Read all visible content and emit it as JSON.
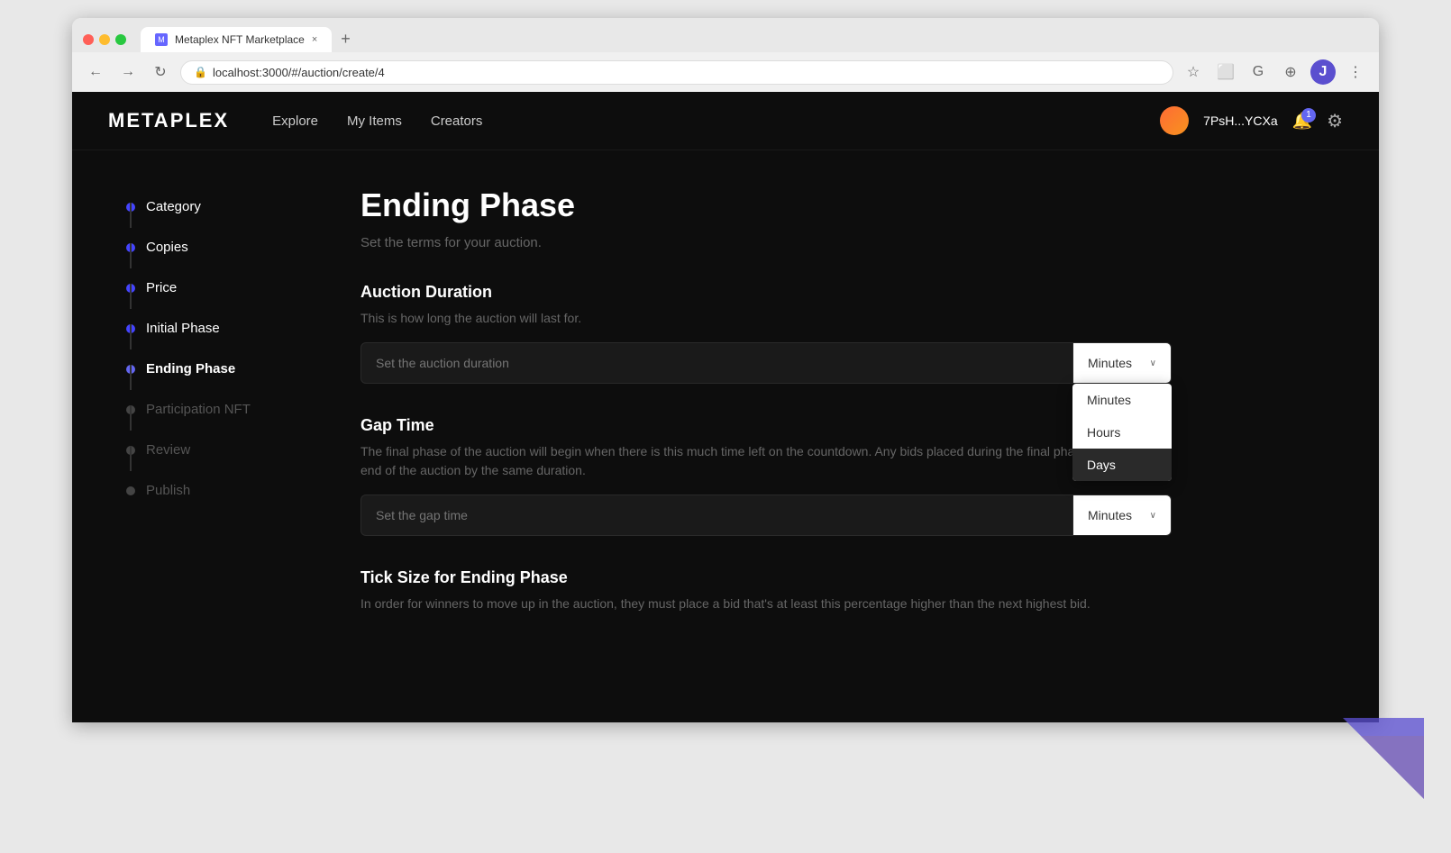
{
  "browser": {
    "tab_title": "Metaplex NFT Marketplace",
    "url": "localhost:3000/#/auction/create/4",
    "new_tab_label": "+",
    "close_tab_label": "×"
  },
  "nav": {
    "logo": "METAPLEX",
    "links": [
      "Explore",
      "My Items",
      "Creators"
    ],
    "wallet_address": "7PsH...YCXa",
    "notification_count": "1"
  },
  "sidebar": {
    "items": [
      {
        "label": "Category",
        "active": true
      },
      {
        "label": "Copies",
        "active": true
      },
      {
        "label": "Price",
        "active": true
      },
      {
        "label": "Initial Phase",
        "active": true
      },
      {
        "label": "Ending Phase",
        "active": true
      },
      {
        "label": "Participation NFT",
        "active": false
      },
      {
        "label": "Review",
        "active": false
      },
      {
        "label": "Publish",
        "active": false
      }
    ]
  },
  "page": {
    "title": "Ending Phase",
    "subtitle": "Set the terms for your auction."
  },
  "auction_duration": {
    "section_title": "Auction Duration",
    "section_description": "This is how long the auction will last for.",
    "input_placeholder": "Set the auction duration",
    "select_value": "Minutes",
    "dropdown_open": true
  },
  "dropdown": {
    "options": [
      "Minutes",
      "Hours",
      "Days"
    ],
    "active_option": "Days"
  },
  "gap_time": {
    "section_title": "Gap Time",
    "section_description": "The final phase of the auction will begin when there is this much time left on the countdown. Any bids placed during the final phase will extend the end of the auction by the same duration.",
    "input_placeholder": "Set the gap time",
    "select_value": "Minutes"
  },
  "tick_size": {
    "section_title": "Tick Size for Ending Phase",
    "section_description": "In order for winners to move up in the auction, they must place a bid that's at least this percentage higher than the next highest bid."
  },
  "icons": {
    "lock": "🔒",
    "chevron_down": "⌄",
    "back": "←",
    "forward": "→",
    "reload": "↻",
    "star": "☆",
    "puzzle": "⋮",
    "bell": "🔔",
    "gear": "⚙"
  }
}
